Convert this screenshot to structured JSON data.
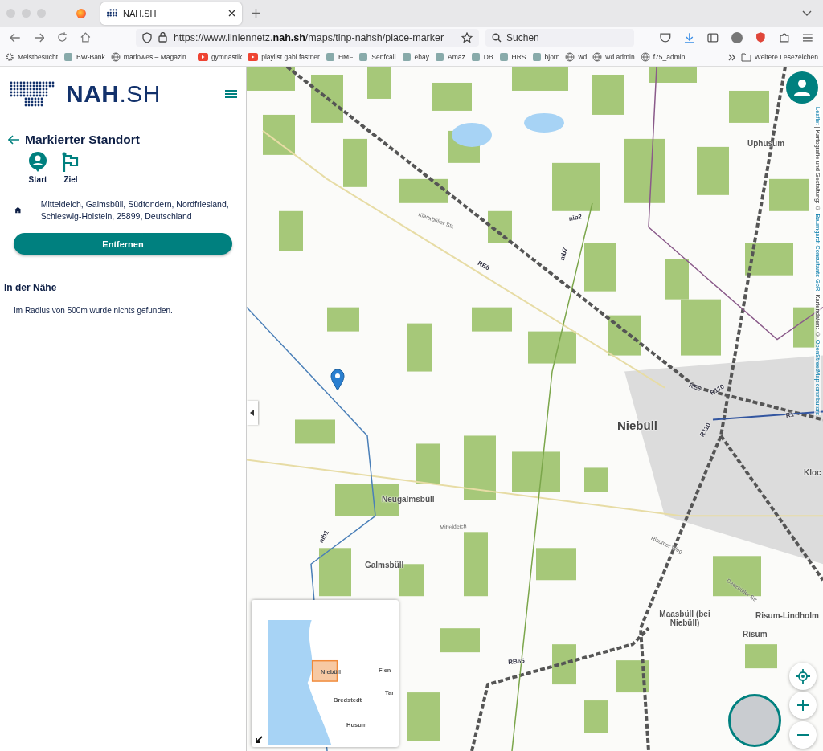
{
  "browser": {
    "tabs": [
      {
        "title": "NAH.SH",
        "selected": true
      }
    ],
    "url": {
      "prefix": "https://www.liniennetz.",
      "host": "nah.sh",
      "path": "/maps/tlnp-nahsh/place-marker"
    },
    "search": {
      "placeholder": "Suchen"
    },
    "bookmarks": [
      "Meistbesucht",
      "BW-Bank",
      "marlowes – Magazin...",
      "gymnastik",
      "playlist gabi fastner",
      "HMF",
      "Senfcall",
      "ebay",
      "Amaz",
      "DB",
      "HRS",
      "björn",
      "wd",
      "wd admin",
      "f75_admin"
    ],
    "more_bookmarks": "Weitere Lesezeichen"
  },
  "sidebar": {
    "logo": {
      "bold": "NAH",
      "light": ".SH"
    },
    "title": "Markierter Standort",
    "actions": [
      {
        "label": "Start"
      },
      {
        "label": "Ziel"
      }
    ],
    "address": "Mitteldeich, Galmsbüll, Südtondern, Nordfriesland, Schleswig-Holstein, 25899, Deutschland",
    "remove_button": "Entfernen",
    "nearby": {
      "heading": "In der Nähe",
      "message": "Im Radius von 500m wurde nichts gefunden."
    }
  },
  "map": {
    "labels": [
      {
        "text": "Uphusum",
        "kind": "place"
      },
      {
        "text": "Niebüll",
        "kind": "town"
      },
      {
        "text": "Kloc",
        "kind": "place"
      },
      {
        "text": "Neugalmsbüll",
        "kind": "place"
      },
      {
        "text": "Galmsbüll",
        "kind": "place"
      },
      {
        "text": "Maasbüll (bei Niebüll)",
        "kind": "place"
      },
      {
        "text": "Risum-Lindholm",
        "kind": "place"
      },
      {
        "text": "Risum",
        "kind": "place"
      },
      {
        "text": "Mitteldeich",
        "kind": "road"
      },
      {
        "text": "Risumer Weg",
        "kind": "road"
      },
      {
        "text": "Deezbüller Str.",
        "kind": "road"
      },
      {
        "text": "Klanxbüller Str.",
        "kind": "road"
      },
      {
        "text": "RE6",
        "kind": "route"
      },
      {
        "text": "RE6",
        "kind": "route"
      },
      {
        "text": "RB65",
        "kind": "route"
      },
      {
        "text": "R110",
        "kind": "route"
      },
      {
        "text": "R110",
        "kind": "route"
      },
      {
        "text": "R1",
        "kind": "route"
      },
      {
        "text": "nib2",
        "kind": "route"
      },
      {
        "text": "nib7",
        "kind": "route"
      },
      {
        "text": "nib1",
        "kind": "route"
      }
    ],
    "minimap_labels": [
      "Niebüll",
      "Flen",
      "Bredstedt",
      "Tar",
      "Husum"
    ],
    "attribution": [
      {
        "text": "Leaflet",
        "link": true
      },
      {
        "text": " | Kartografie und Gestaltung: © ",
        "link": false
      },
      {
        "text": "Baumgardt Consultants GbR",
        "link": true
      },
      {
        "text": ", Kartendaten: © ",
        "link": false
      },
      {
        "text": "OpenStreetMap contributors",
        "link": true
      }
    ]
  }
}
